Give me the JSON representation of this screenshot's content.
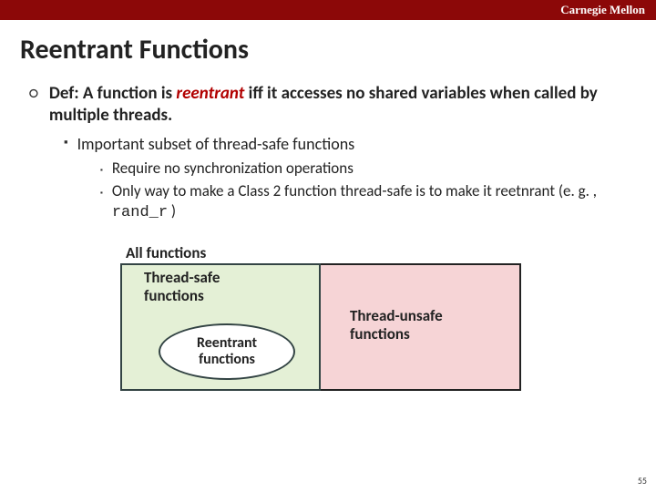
{
  "header": {
    "institution": "Carnegie Mellon"
  },
  "title": "Reentrant Functions",
  "def": {
    "prefix": "Def: A function is ",
    "keyword": "reentrant",
    "suffix": " iff it accesses no shared variables when called by multiple threads."
  },
  "sub1": "Important subset of thread-safe functions",
  "sub2a": "Require no synchronization operations",
  "sub2b_pre": "Only way to make a Class 2 function thread-safe is to make it reetnrant (e. g. , ",
  "sub2b_code": "rand_r",
  "sub2b_post": " )",
  "diagram": {
    "all": "All functions",
    "safe": "Thread-safe functions",
    "unsafe": "Thread-unsafe functions",
    "reentrant": "Reentrant functions"
  },
  "page": "55"
}
